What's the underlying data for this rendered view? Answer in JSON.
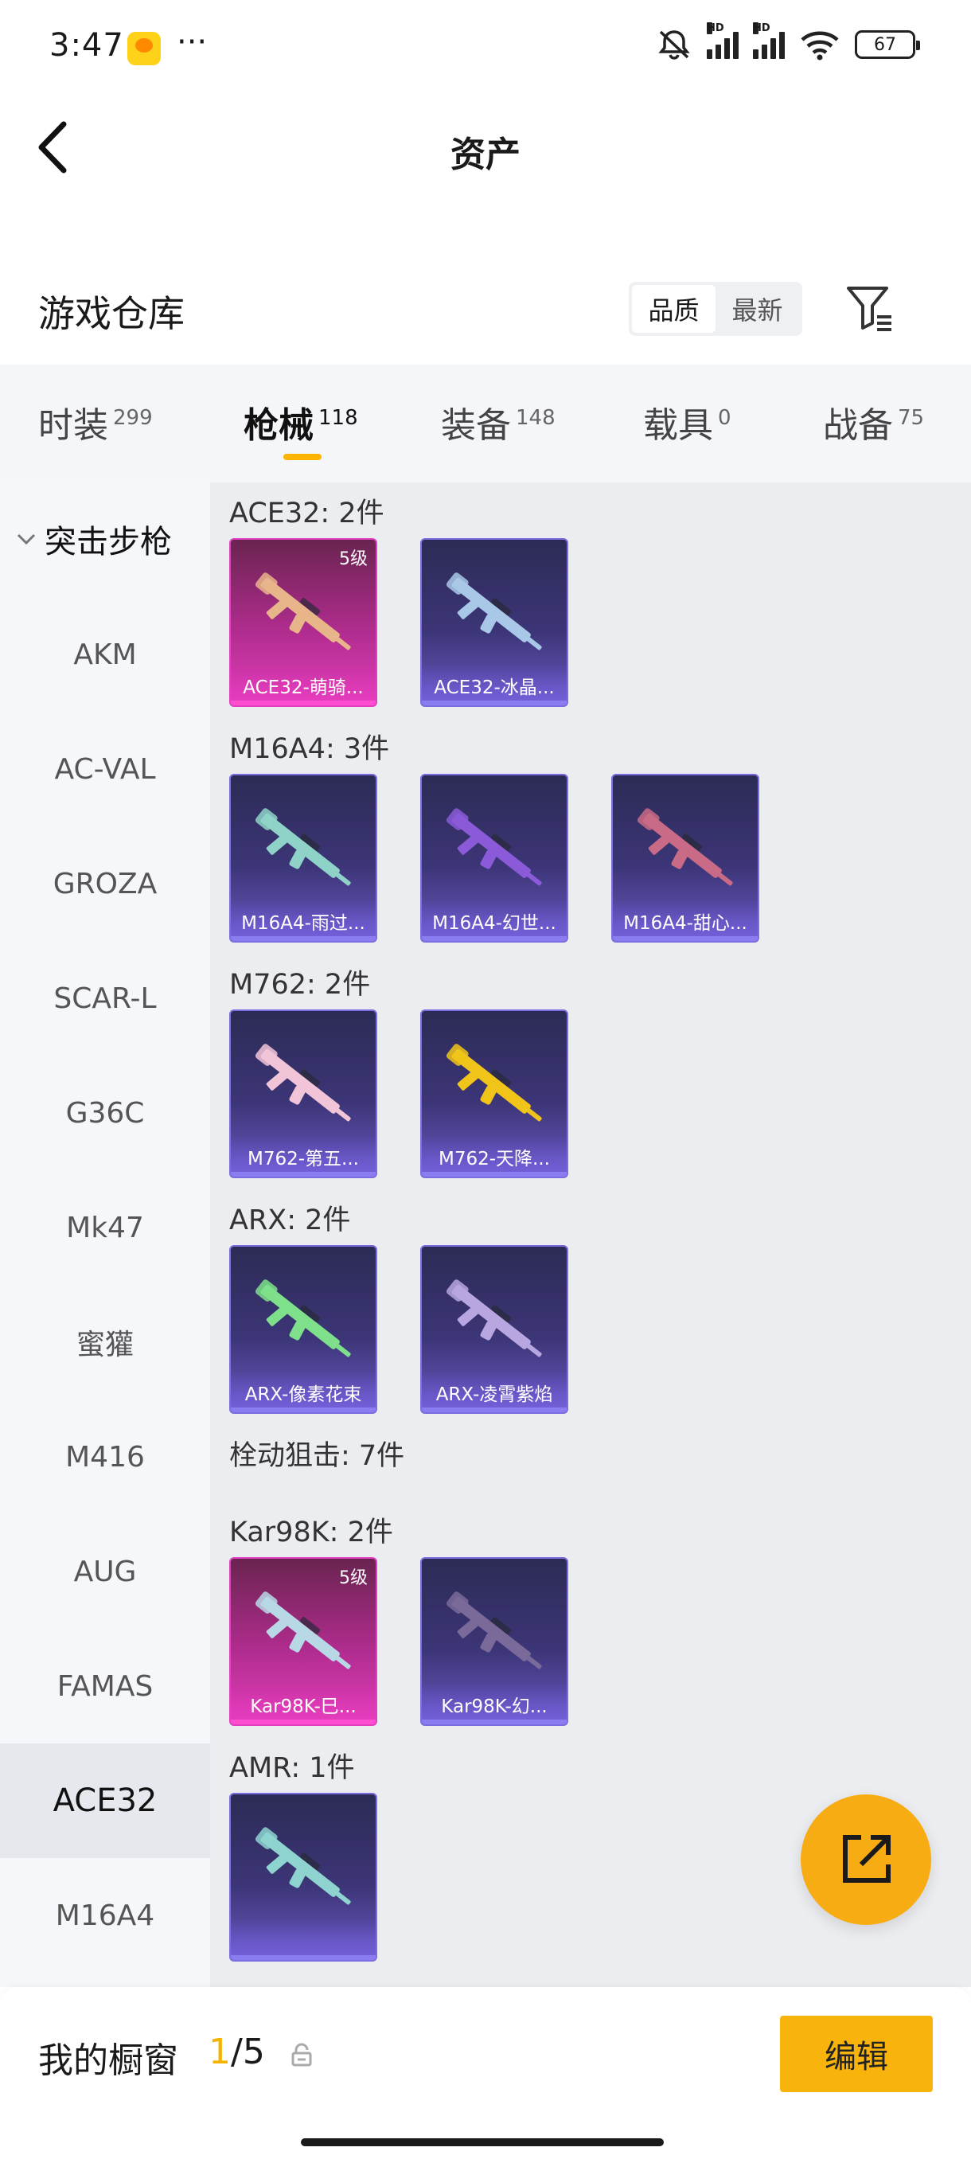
{
  "status_bar": {
    "time": "3:47",
    "more": "···",
    "battery": "67",
    "icons": [
      "app-icon",
      "mute-icon",
      "signal-icon",
      "signal-icon",
      "wifi-icon",
      "battery-icon"
    ],
    "hd1": "HD",
    "hd2": "HD"
  },
  "header": {
    "title": "资产"
  },
  "section": {
    "title": "游戏仓库",
    "sort_quality": "品质",
    "sort_newest": "最新"
  },
  "tabs": [
    {
      "label": "时装",
      "count": "299"
    },
    {
      "label": "枪械",
      "count": "118"
    },
    {
      "label": "装备",
      "count": "148"
    },
    {
      "label": "载具",
      "count": "0"
    },
    {
      "label": "战备",
      "count": "75"
    }
  ],
  "sidebar": {
    "group": "突击步枪",
    "items": [
      "AKM",
      "AC-VAL",
      "GROZA",
      "SCAR-L",
      "G36C",
      "Mk47",
      "蜜獾",
      "M416",
      "AUG",
      "FAMAS",
      "ACE32",
      "M16A4"
    ]
  },
  "groups": [
    {
      "label": "ACE32: 2件",
      "items": [
        {
          "name": "ACE32-萌骑...",
          "level": "5级",
          "rarity": "pink",
          "gun_color": "#e8b48a"
        },
        {
          "name": "ACE32-冰晶...",
          "level": "",
          "rarity": "purple",
          "gun_color": "#a9c8e8"
        }
      ]
    },
    {
      "label": "M16A4: 3件",
      "items": [
        {
          "name": "M16A4-雨过...",
          "level": "",
          "rarity": "purple",
          "gun_color": "#8fd3c8"
        },
        {
          "name": "M16A4-幻世...",
          "level": "",
          "rarity": "purple",
          "gun_color": "#8a5ad8"
        },
        {
          "name": "M16A4-甜心...",
          "level": "",
          "rarity": "purple",
          "gun_color": "#c96a86"
        }
      ]
    },
    {
      "label": "M762: 2件",
      "items": [
        {
          "name": "M762-第五...",
          "level": "",
          "rarity": "purple",
          "gun_color": "#f2c4d8"
        },
        {
          "name": "M762-天降...",
          "level": "",
          "rarity": "purple",
          "gun_color": "#f1c419"
        }
      ]
    },
    {
      "label": "ARX: 2件",
      "items": [
        {
          "name": "ARX-像素花束",
          "level": "",
          "rarity": "purple",
          "gun_color": "#7ee08a"
        },
        {
          "name": "ARX-凌霄紫焰",
          "level": "",
          "rarity": "purple",
          "gun_color": "#b7a6e0"
        }
      ]
    },
    {
      "label": "栓动狙击: 7件",
      "items": []
    },
    {
      "label": "Kar98K: 2件",
      "items": [
        {
          "name": "Kar98K-巳...",
          "level": "5级",
          "rarity": "pink",
          "gun_color": "#b9d8e6"
        },
        {
          "name": "Kar98K-幻...",
          "level": "",
          "rarity": "purple",
          "gun_color": "#7a6a9a"
        }
      ]
    },
    {
      "label": "AMR: 1件",
      "items": [
        {
          "name": "",
          "level": "",
          "rarity": "purple",
          "gun_color": "#8ed3cf"
        }
      ]
    }
  ],
  "bottom": {
    "showcase_label": "我的橱窗",
    "showcase_current": "1",
    "showcase_total": "/5",
    "edit": "编辑"
  },
  "colors": {
    "accent": "#f8b40c",
    "rarity_pink": "#e23fbb",
    "rarity_purple": "#6a58c2"
  }
}
